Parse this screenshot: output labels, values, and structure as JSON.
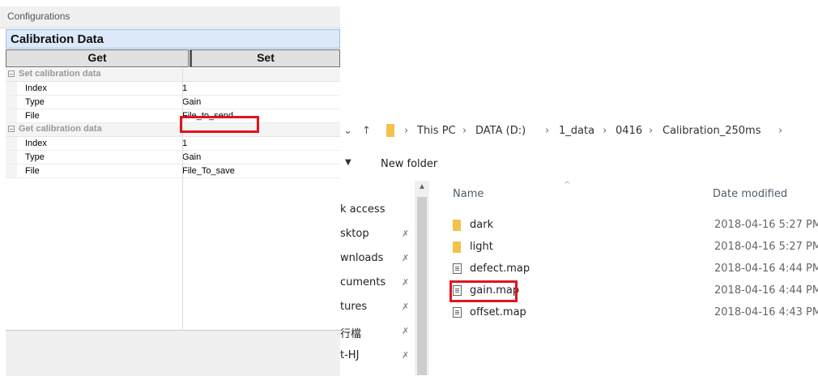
{
  "config_panel": {
    "header": "Configurations",
    "section_title": "Calibration Data",
    "get_button": "Get",
    "set_button": "Set",
    "groups": [
      {
        "label": "Set calibration data",
        "rows": [
          {
            "key": "Index",
            "value": "1"
          },
          {
            "key": "Type",
            "value": "Gain"
          },
          {
            "key": "File",
            "value": "File_to_send"
          }
        ]
      },
      {
        "label": "Get calibration data",
        "rows": [
          {
            "key": "Index",
            "value": "1"
          },
          {
            "key": "Type",
            "value": "Gain"
          },
          {
            "key": "File",
            "value": "File_To_save"
          }
        ]
      }
    ]
  },
  "explorer": {
    "breadcrumb": [
      "This PC",
      "DATA (D:)",
      "1_data",
      "0416",
      "Calibration_250ms"
    ],
    "toolbar": {
      "new_folder": "New folder"
    },
    "nav_items": [
      {
        "label": "k access",
        "pinned": false
      },
      {
        "label": "sktop",
        "pinned": true
      },
      {
        "label": "wnloads",
        "pinned": true
      },
      {
        "label": "cuments",
        "pinned": true
      },
      {
        "label": "tures",
        "pinned": true
      },
      {
        "label": "行檔",
        "pinned": true
      },
      {
        "label": "t-HJ",
        "pinned": true
      }
    ],
    "columns": {
      "name": "Name",
      "date": "Date modified"
    },
    "files": [
      {
        "name": "dark",
        "kind": "folder",
        "date": "2018-04-16 5:27 PM"
      },
      {
        "name": "light",
        "kind": "folder",
        "date": "2018-04-16 5:27 PM"
      },
      {
        "name": "defect.map",
        "kind": "file",
        "date": "2018-04-16 4:44 PM"
      },
      {
        "name": "gain.map",
        "kind": "file",
        "date": "2018-04-16 4:44 PM"
      },
      {
        "name": "offset.map",
        "kind": "file",
        "date": "2018-04-16 4:43 PM"
      }
    ]
  },
  "highlight_color": "#e0141c"
}
